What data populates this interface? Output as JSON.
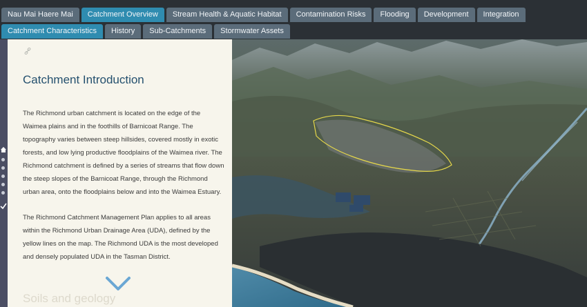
{
  "tabs_row1": [
    "Nau Mai Haere Mai",
    "Catchment Overview",
    "Stream Health & Aquatic Habitat",
    "Contamination Risks",
    "Flooding",
    "Development",
    "Integration"
  ],
  "tabs_row2": [
    "Catchment Characteristics",
    "History",
    "Sub-Catchments",
    "Stormwater Assets"
  ],
  "active_tabs": [
    "Catchment Overview",
    "Catchment Characteristics"
  ],
  "panel": {
    "title": "Catchment Introduction",
    "paragraph1": "The Richmond urban catchment is located on the edge of the Waimea plains and in the foothills of Barnicoat Range. The topography varies between steep hillsides, covered mostly in exotic forests, and low lying productive floodplains of the Waimea river. The Richmond catchment is defined by a series of streams that flow down the steep slopes of the Barnicoat Range, through the Richmond urban area, onto the floodplains below and into the Waimea Estuary.",
    "paragraph2": "The Richmond Catchment Management Plan applies to all areas within the Richmond Urban Drainage Area (UDA), defined by the yellow lines on the map. The Richmond UDA is the most developed and densely populated UDA in the Tasman District.",
    "next_section": "Soils and geology"
  },
  "icons": {
    "link": "link-icon",
    "home": "home-icon",
    "check": "check-icon",
    "down": "chevron-down-icon"
  },
  "colors": {
    "active_tab": "#2f8cb0",
    "tab": "#5b6c7a",
    "topbar": "#2b3035",
    "panel_bg": "#f7f5ec",
    "title": "#24506e",
    "chevron": "#6aa7d4",
    "uda_boundary": "#e6d84a"
  }
}
